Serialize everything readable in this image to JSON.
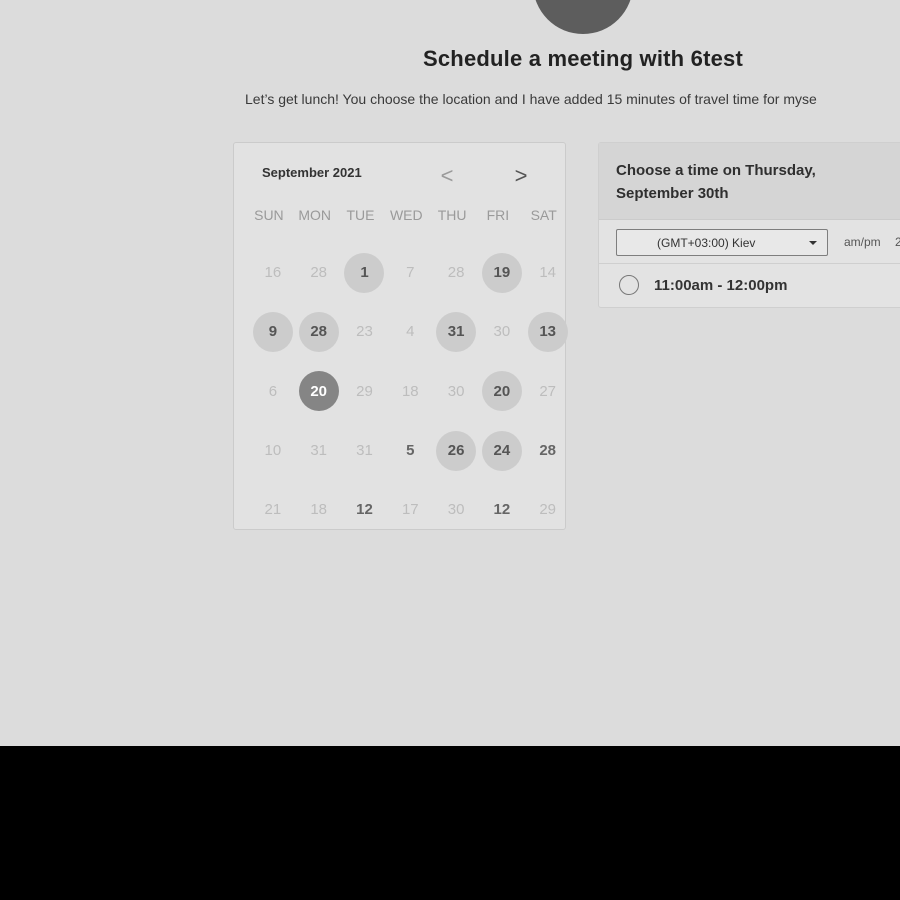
{
  "header": {
    "title": "Schedule a meeting with 6test",
    "subtitle": "Let’s get lunch! You choose the location and I have added 15 minutes of travel time for myse"
  },
  "calendar": {
    "month_label": "September 2021",
    "prev_icon": "<",
    "next_icon": ">",
    "weekdays": [
      "SUN",
      "MON",
      "TUE",
      "WED",
      "THU",
      "FRI",
      "SAT"
    ],
    "weeks": [
      [
        {
          "label": "16",
          "state": "muted"
        },
        {
          "label": "28",
          "state": "muted"
        },
        {
          "label": "1",
          "state": "available"
        },
        {
          "label": "7",
          "state": "muted"
        },
        {
          "label": "28",
          "state": "muted"
        },
        {
          "label": "19",
          "state": "available"
        },
        {
          "label": "14",
          "state": "muted"
        }
      ],
      [
        {
          "label": "9",
          "state": "available"
        },
        {
          "label": "28",
          "state": "available"
        },
        {
          "label": "23",
          "state": "muted"
        },
        {
          "label": "4",
          "state": "muted"
        },
        {
          "label": "31",
          "state": "available"
        },
        {
          "label": "30",
          "state": "muted"
        },
        {
          "label": "13",
          "state": "available"
        }
      ],
      [
        {
          "label": "6",
          "state": "muted"
        },
        {
          "label": "20",
          "state": "selected"
        },
        {
          "label": "29",
          "state": "muted"
        },
        {
          "label": "18",
          "state": "muted"
        },
        {
          "label": "30",
          "state": "muted"
        },
        {
          "label": "20",
          "state": "available"
        },
        {
          "label": "27",
          "state": "muted"
        }
      ],
      [
        {
          "label": "10",
          "state": "muted"
        },
        {
          "label": "31",
          "state": "muted"
        },
        {
          "label": "31",
          "state": "muted"
        },
        {
          "label": "5",
          "state": "normal"
        },
        {
          "label": "26",
          "state": "available"
        },
        {
          "label": "24",
          "state": "available"
        },
        {
          "label": "28",
          "state": "normal"
        }
      ],
      [
        {
          "label": "21",
          "state": "muted"
        },
        {
          "label": "18",
          "state": "muted"
        },
        {
          "label": "12",
          "state": "normal"
        },
        {
          "label": "17",
          "state": "muted"
        },
        {
          "label": "30",
          "state": "muted"
        },
        {
          "label": "12",
          "state": "normal"
        },
        {
          "label": "29",
          "state": "muted"
        }
      ]
    ]
  },
  "time_panel": {
    "title": "Choose a time on Thursday, September 30th",
    "timezone": "(GMT+03:00) Kiev",
    "format_toggle": "am/pm",
    "format_alt": "2",
    "slots": [
      {
        "label": "11:00am - 12:00pm"
      }
    ]
  }
}
